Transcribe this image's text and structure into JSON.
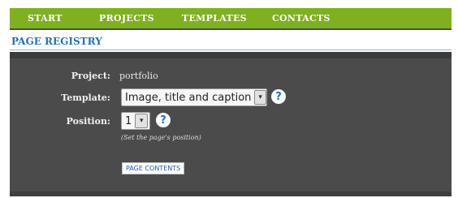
{
  "nav": {
    "items": [
      {
        "label": "START"
      },
      {
        "label": "PROJECTS"
      },
      {
        "label": "TEMPLATES"
      },
      {
        "label": "CONTACTS"
      }
    ]
  },
  "page": {
    "title": "PAGE REGISTRY"
  },
  "form": {
    "project_label": "Project:",
    "project_value": "portfolio",
    "template_label": "Template:",
    "template_selected": "Image, title and caption",
    "position_label": "Position:",
    "position_selected": "1",
    "position_hint": "(Set the page's position)",
    "submit_label": "PAGE CONTENTS"
  },
  "colors": {
    "nav_bg": "#7fb01f",
    "title": "#2672b8",
    "panel_bg": "#4b4b4b",
    "help": "#1e6fd1"
  },
  "icons": {
    "chevron": "chevron-down-icon",
    "help": "help-icon"
  }
}
